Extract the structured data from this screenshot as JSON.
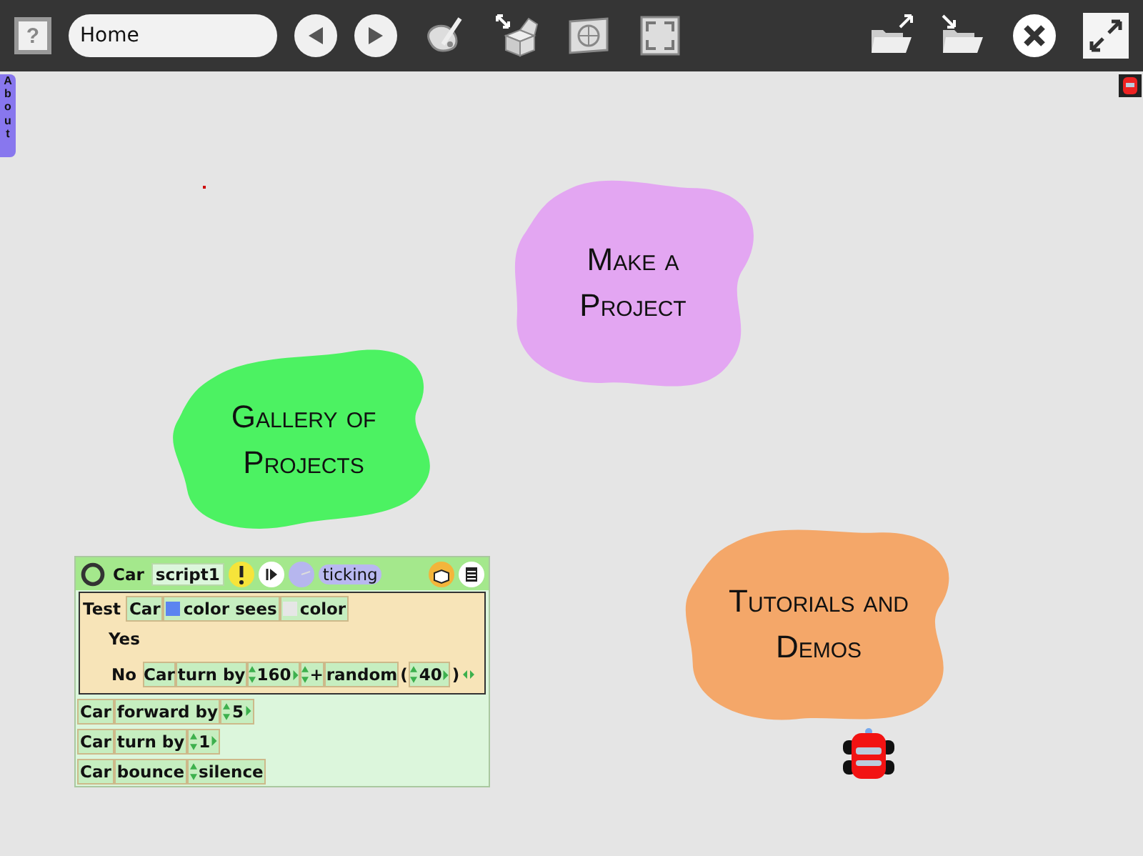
{
  "toolbar": {
    "help": "?",
    "location": "Home"
  },
  "about_tab": "About",
  "blobs": [
    {
      "label": "Make a Project",
      "color": "#e3a6f2"
    },
    {
      "label": "Gallery of Projects",
      "color": "#4cf262"
    },
    {
      "label": "Tutorials and Demos",
      "color": "#f4a769"
    }
  ],
  "script": {
    "object": "Car",
    "name": "script1",
    "status": "ticking",
    "test": {
      "label": "Test",
      "tiles": [
        {
          "kind": "tile",
          "text": "Car"
        },
        {
          "kind": "swatch",
          "color": "#5b84f0",
          "text": "color  sees"
        },
        {
          "kind": "swatch",
          "color": "#e6e6e6",
          "text": "color"
        }
      ],
      "yes": "Yes",
      "no": "No",
      "no_tiles": [
        {
          "kind": "tile",
          "text": "Car"
        },
        {
          "kind": "tile",
          "text": "turn by"
        },
        {
          "kind": "number",
          "text": "160"
        },
        {
          "kind": "op",
          "text": "+"
        },
        {
          "kind": "tile",
          "text": "random"
        },
        {
          "kind": "paren",
          "text": "("
        },
        {
          "kind": "number",
          "text": "40"
        },
        {
          "kind": "paren",
          "text": ")"
        }
      ]
    },
    "rows": [
      [
        {
          "kind": "tile",
          "text": "Car"
        },
        {
          "kind": "tile",
          "text": "forward by"
        },
        {
          "kind": "number",
          "text": "5"
        }
      ],
      [
        {
          "kind": "tile",
          "text": "Car"
        },
        {
          "kind": "tile",
          "text": "turn by"
        },
        {
          "kind": "number",
          "text": "1"
        }
      ],
      [
        {
          "kind": "tile",
          "text": "Car"
        },
        {
          "kind": "tile",
          "text": "bounce"
        },
        {
          "kind": "choice",
          "text": "silence"
        }
      ]
    ]
  }
}
